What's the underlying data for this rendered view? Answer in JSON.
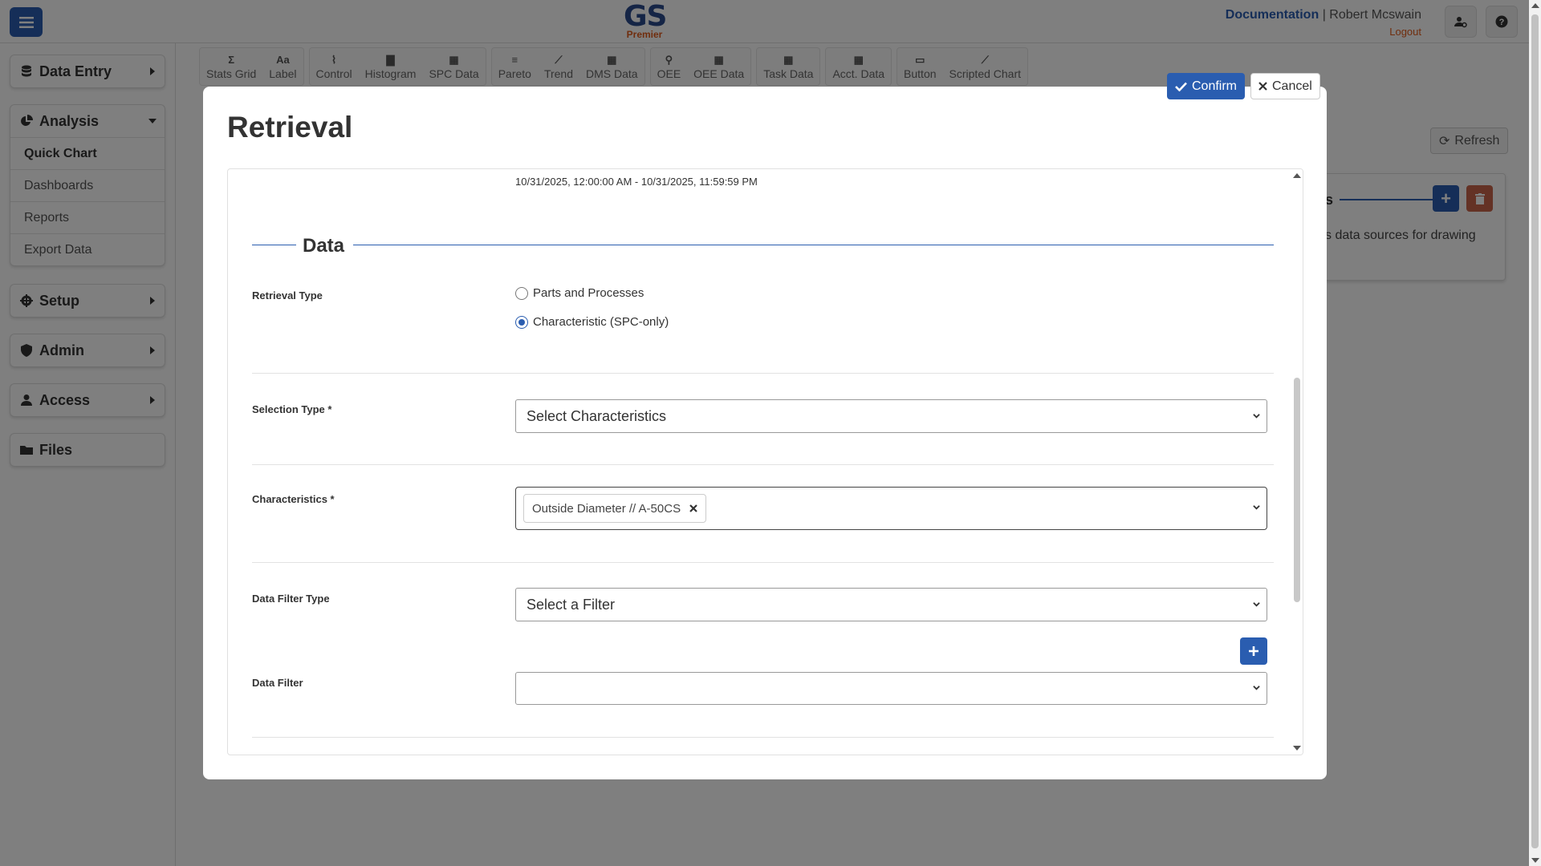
{
  "app": {
    "logo_text": "GS",
    "logo_sub": "Premier",
    "documentation_link": "Documentation",
    "separator": "|",
    "user_name": "Robert Mcswain",
    "logout_link": "Logout",
    "icons": {
      "menu": "hamburger-icon",
      "user_settings": "user-gear-icon",
      "help": "question-icon"
    }
  },
  "sidebar": {
    "data_entry": "Data Entry",
    "analysis": "Analysis",
    "analysis_items": [
      "Quick Chart",
      "Dashboards",
      "Reports",
      "Export Data"
    ],
    "setup": "Setup",
    "admin": "Admin",
    "access": "Access",
    "files": "Files"
  },
  "toolbar": {
    "items": [
      {
        "glyph": "Σ",
        "label": "Stats Grid"
      },
      {
        "glyph": "Aa",
        "label": "Label"
      },
      {
        "glyph": "⌇",
        "label": "Control"
      },
      {
        "glyph": "▇",
        "label": "Histogram"
      },
      {
        "glyph": "▦",
        "label": "SPC Data"
      },
      {
        "glyph": "≡",
        "label": "Pareto"
      },
      {
        "glyph": "⟋",
        "label": "Trend"
      },
      {
        "glyph": "▦",
        "label": "DMS Data"
      },
      {
        "glyph": "⚲",
        "label": "OEE"
      },
      {
        "glyph": "▦",
        "label": "OEE Data"
      },
      {
        "glyph": "▦",
        "label": "Task Data"
      },
      {
        "glyph": "▦",
        "label": "Acct. Data"
      },
      {
        "glyph": "▭",
        "label": "Button"
      },
      {
        "glyph": "⟋",
        "label": "Scripted Chart"
      }
    ]
  },
  "background": {
    "refresh_label": "Refresh",
    "card_title_fragment": "s",
    "card_desc_fragment": "s data sources for drawing"
  },
  "modal": {
    "title": "Retrieval",
    "confirm_label": "Confirm",
    "cancel_label": "Cancel",
    "date_range": "10/31/2025, 12:00:00 AM - 10/31/2025, 11:59:59 PM",
    "section_title": "Data",
    "retrieval_type_label": "Retrieval Type",
    "retrieval_options": [
      "Parts and Processes",
      "Characteristic (SPC-only)"
    ],
    "retrieval_selected": "Characteristic (SPC-only)",
    "selection_type_label": "Selection Type *",
    "selection_type_value": "Select Characteristics",
    "characteristics_label": "Characteristics *",
    "characteristics_selected": [
      "Outside Diameter // A-50CS"
    ],
    "data_filter_type_label": "Data Filter Type",
    "data_filter_type_value": "Select a Filter",
    "data_filter_label": "Data Filter",
    "data_filter_value": ""
  },
  "colors": {
    "primary": "#2a5db0",
    "accent": "#e05a1a",
    "danger": "#c9654a",
    "overlay": "rgba(0,0,0,0.5)"
  }
}
